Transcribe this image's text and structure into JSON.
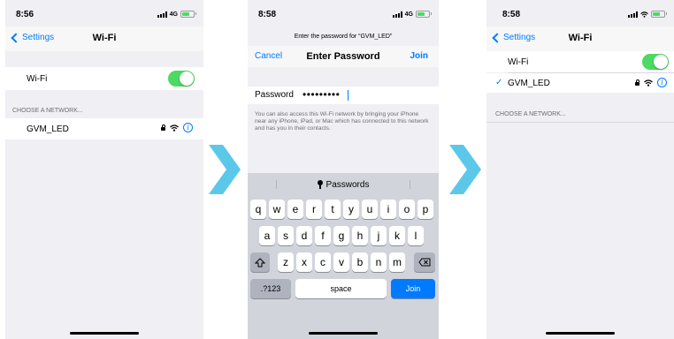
{
  "screen1": {
    "time": "8:56",
    "network": "4G",
    "back_label": "Settings",
    "title": "Wi-Fi",
    "wifi_label": "Wi-Fi",
    "wifi_on": true,
    "section_header": "CHOOSE A NETWORK...",
    "network_name": "GVM_LED",
    "info_symbol": "i"
  },
  "screen2": {
    "time": "8:58",
    "network": "4G",
    "prompt": "Enter the password for “GVM_LED”",
    "cancel_label": "Cancel",
    "title": "Enter Password",
    "join_label": "Join",
    "password_label": "Password",
    "password_value": "•••••••••",
    "info_text": "You can also access this Wi-Fi network by bringing your iPhone near any iPhone, iPad, or Mac which has connected to this network and has you in their contacts.",
    "keyboard": {
      "suggestion": "Passwords",
      "row1": [
        "q",
        "w",
        "e",
        "r",
        "t",
        "y",
        "u",
        "i",
        "o",
        "p"
      ],
      "row2": [
        "a",
        "s",
        "d",
        "f",
        "g",
        "h",
        "j",
        "k",
        "l"
      ],
      "row3": [
        "z",
        "x",
        "c",
        "v",
        "b",
        "n",
        "m"
      ],
      "numbers_key": ".?123",
      "space_key": "space",
      "join_key": "Join"
    }
  },
  "screen3": {
    "time": "8:58",
    "back_label": "Settings",
    "title": "Wi-Fi",
    "wifi_label": "Wi-Fi",
    "wifi_on": true,
    "connected_network": "GVM_LED",
    "checkmark": "✓",
    "info_symbol": "i",
    "section_header": "CHOOSE A NETWORK..."
  },
  "colors": {
    "accent": "#007aff",
    "toggle_on": "#4cd964",
    "arrow": "#5bc8ea",
    "background": "#efeff4"
  }
}
